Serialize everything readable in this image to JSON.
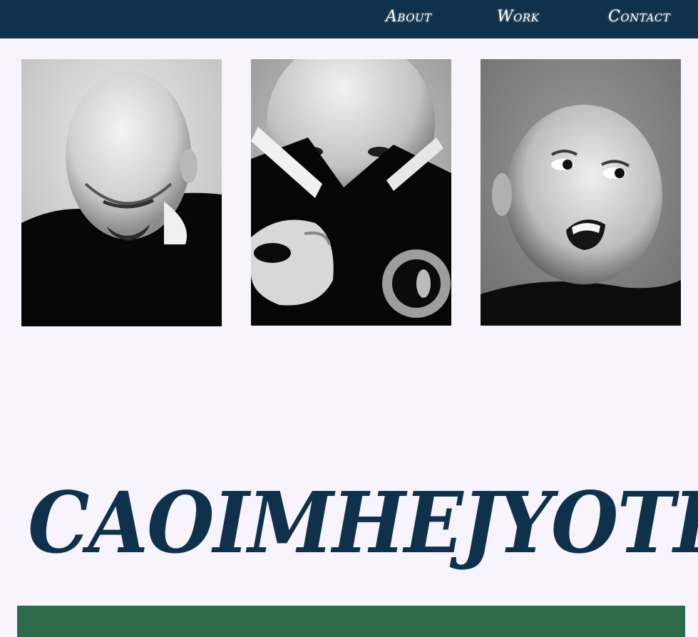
{
  "nav": {
    "about_label": "About",
    "work_label": "Work",
    "contact_label": "Contact"
  },
  "site_title": "CAOIMHEJYOTI",
  "colors": {
    "navbar": "#0f314c",
    "background": "#f8f4fd",
    "title": "#0f314c",
    "footer_band": "#2e6a4a"
  }
}
